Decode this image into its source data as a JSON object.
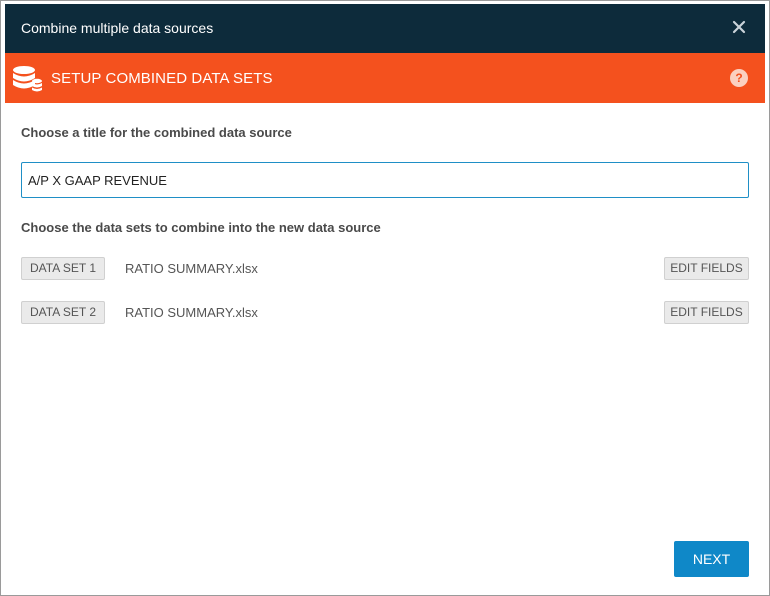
{
  "window": {
    "title": "Combine multiple data sources",
    "close_icon": "close-icon"
  },
  "banner": {
    "icon": "database-icon",
    "heading": "SETUP COMBINED DATA SETS",
    "help_label": "?",
    "color": "#f4511e"
  },
  "form": {
    "title_label": "Choose a title for the combined data source",
    "title_value": "A/P X GAAP REVENUE",
    "datasets_label": "Choose the data sets to combine into the new data source",
    "datasets": [
      {
        "badge": "DATA SET 1",
        "file": "RATIO SUMMARY.xlsx",
        "edit_label": "EDIT FIELDS"
      },
      {
        "badge": "DATA SET 2",
        "file": "RATIO SUMMARY.xlsx",
        "edit_label": "EDIT FIELDS"
      }
    ]
  },
  "footer": {
    "next_label": "NEXT",
    "accent": "#0f88c8"
  },
  "colors": {
    "titlebar": "#0d2b3b",
    "banner": "#f4511e",
    "primary_button": "#0f88c8"
  }
}
